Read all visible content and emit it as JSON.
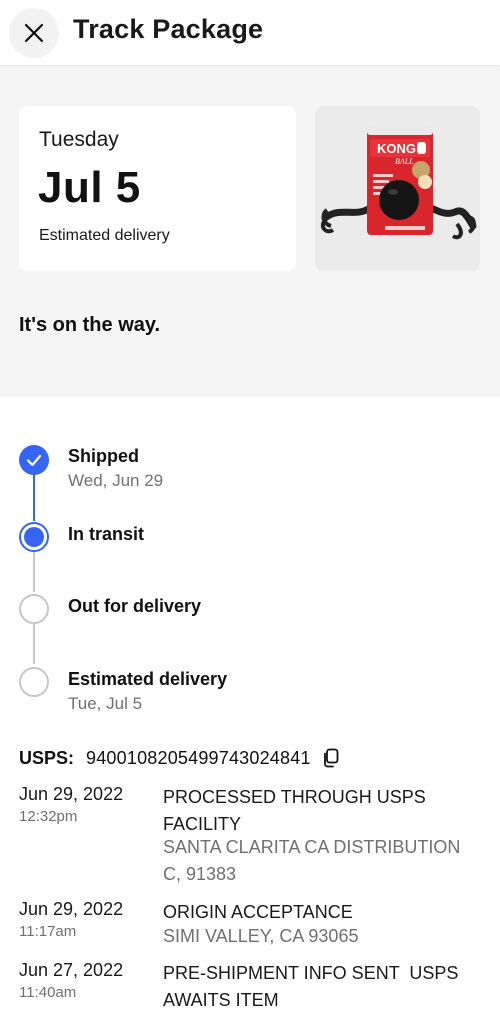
{
  "header": {
    "title": "Track Package",
    "close_icon": "close-icon"
  },
  "summary": {
    "day": "Tuesday",
    "date": "Jul 5",
    "estimated_label": "Estimated delivery",
    "status_message": "It's on the way.",
    "product_text": {
      "brand": "KONG",
      "name": "BALL"
    }
  },
  "timeline": {
    "steps": [
      {
        "title": "Shipped",
        "subtitle": "Wed, Jun 29",
        "state": "done"
      },
      {
        "title": "In transit",
        "subtitle": "",
        "state": "current"
      },
      {
        "title": "Out for delivery",
        "subtitle": "",
        "state": "pending"
      },
      {
        "title": "Estimated delivery",
        "subtitle": "Tue, Jul 5",
        "state": "pending"
      }
    ],
    "colors": {
      "active": "#3665f3",
      "inactive": "#c7c7c7"
    }
  },
  "tracking": {
    "carrier": "USPS:",
    "number": "9400108205499743024841",
    "events": [
      {
        "date": "Jun 29, 2022",
        "time": "12:32pm",
        "description": "PROCESSED THROUGH USPS FACILITY",
        "location": "SANTA CLARITA CA DISTRIBUTION C, 91383"
      },
      {
        "date": "Jun 29, 2022",
        "time": "11:17am",
        "description": "ORIGIN ACCEPTANCE",
        "location": "SIMI VALLEY, CA 93065"
      },
      {
        "date": "Jun 27, 2022",
        "time": "11:40am",
        "description": "PRE-SHIPMENT INFO SENT  USPS AWAITS ITEM",
        "location": ""
      }
    ]
  }
}
